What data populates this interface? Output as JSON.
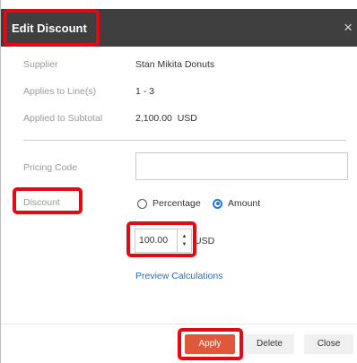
{
  "dialog": {
    "title": "Edit Discount",
    "close_icon": "×",
    "fields": {
      "supplier_label": "Supplier",
      "supplier_value": "Stan Mikita Donuts",
      "applies_label": "Applies to Line(s)",
      "applies_value": "1 - 3",
      "subtotal_label": "Applied to Subtotal",
      "subtotal_value": "2,100.00  USD",
      "pricing_code_label": "Pricing Code",
      "pricing_code_value": "",
      "discount_label": "Discount"
    },
    "discount_type": {
      "options": [
        "Percentage",
        "Amount"
      ],
      "selected": "Amount"
    },
    "amount": {
      "value": "100.00",
      "unit": "USD",
      "spin_up": "▲",
      "spin_down": "▼"
    },
    "preview_link": "Preview Calculations",
    "buttons": {
      "apply": "Apply",
      "delete": "Delete",
      "close": "Close"
    }
  },
  "colors": {
    "titlebar": "#3f3f3f",
    "highlight": "#e50914",
    "apply_button": "#e0583a",
    "radio_selected": "#2a79d8",
    "link": "#2f6eb5"
  }
}
